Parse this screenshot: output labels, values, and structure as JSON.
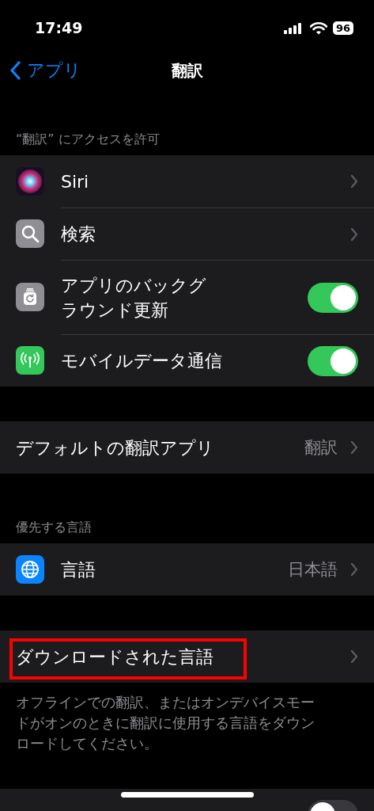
{
  "status_bar": {
    "time": "17:49",
    "battery": "96"
  },
  "nav": {
    "back": "アプリ",
    "title": "翻訳"
  },
  "sections": [
    {
      "header": "“翻訳” にアクセスを許可",
      "rows": [
        {
          "kind": "link",
          "label": "Siri"
        },
        {
          "kind": "link",
          "label": "検索"
        },
        {
          "kind": "toggle",
          "label": "アプリのバックグラウンド更新",
          "on": true
        },
        {
          "kind": "toggle",
          "label": "モバイルデータ通信",
          "on": true
        }
      ]
    },
    {
      "rows": [
        {
          "kind": "link",
          "label": "デフォルトの翻訳アプリ",
          "value": "翻訳"
        }
      ]
    },
    {
      "header": "優先する言語",
      "rows": [
        {
          "kind": "link",
          "label": "言語",
          "value": "日本語"
        }
      ]
    },
    {
      "rows": [
        {
          "kind": "link",
          "label": "ダウンロードされた言語",
          "highlighted": true
        }
      ],
      "footer": "オフラインでの翻訳、またはオンデバイスモードがオンのときに翻訳に使用する言語をダウンロードしてください。"
    },
    {
      "rows": [
        {
          "kind": "toggle",
          "on": false
        }
      ]
    }
  ]
}
